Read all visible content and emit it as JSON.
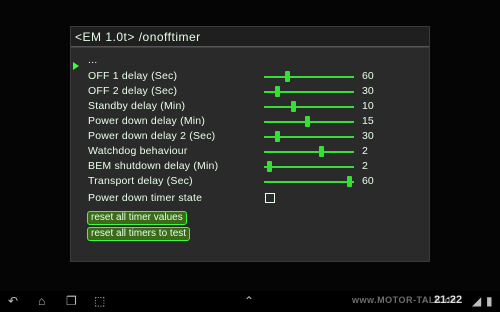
{
  "header": {
    "path": "<EM 1.0t> /onofftimer"
  },
  "menu": {
    "parent_item": "...",
    "rows": [
      {
        "label": "OFF 1 delay (Sec)",
        "value": "60",
        "level": 0.25
      },
      {
        "label": "OFF 2 delay (Sec)",
        "value": "30",
        "level": 0.13
      },
      {
        "label": "Standby delay (Min)",
        "value": "10",
        "level": 0.32
      },
      {
        "label": "Power down delay (Min)",
        "value": "15",
        "level": 0.48
      },
      {
        "label": "Power down delay 2 (Sec)",
        "value": "30",
        "level": 0.13
      },
      {
        "label": "Watchdog behaviour",
        "value": "2",
        "level": 0.65
      },
      {
        "label": "BEM shutdown delay (Min)",
        "value": "2",
        "level": 0.04
      },
      {
        "label": "Transport delay (Sec)",
        "value": "60",
        "level": 0.98
      }
    ],
    "checkbox_row": {
      "label": "Power down timer state",
      "checked": false
    },
    "actions": {
      "reset_all": "reset all timer values",
      "reset_test": "reset all timers to test"
    }
  },
  "status_bar": {
    "watermark": "www.MOTOR-TALK.de",
    "time": "21:22"
  },
  "colors": {
    "accent": "#39ff39",
    "screen_bg": "#2a2a2a",
    "text": "#e8ffe8"
  }
}
